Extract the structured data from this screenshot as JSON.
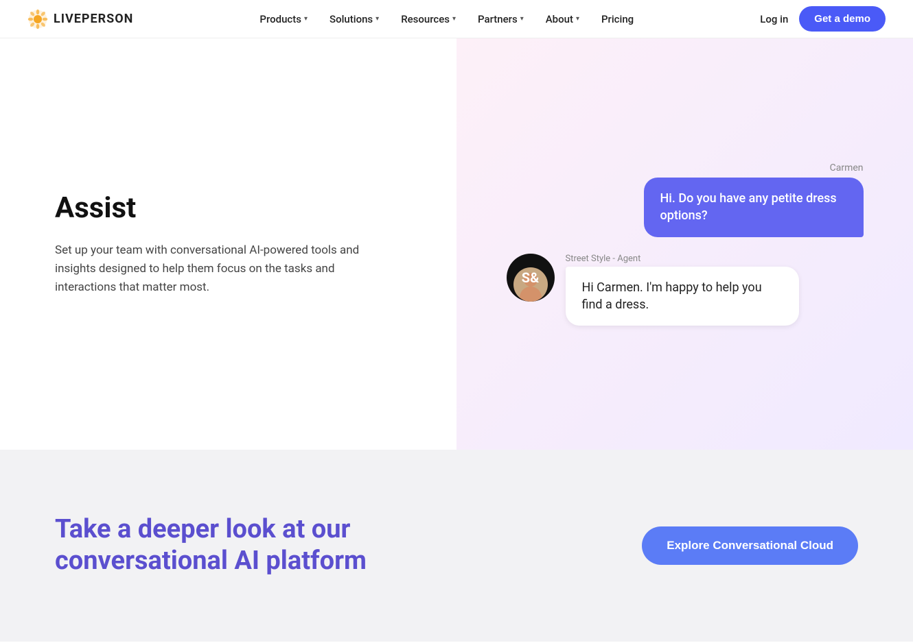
{
  "navbar": {
    "logo_text": "LIVEPERSON",
    "nav_items": [
      {
        "id": "products",
        "label": "Products",
        "has_dropdown": true
      },
      {
        "id": "solutions",
        "label": "Solutions",
        "has_dropdown": true
      },
      {
        "id": "resources",
        "label": "Resources",
        "has_dropdown": true
      },
      {
        "id": "partners",
        "label": "Partners",
        "has_dropdown": true
      },
      {
        "id": "about",
        "label": "About",
        "has_dropdown": true
      },
      {
        "id": "pricing",
        "label": "Pricing",
        "has_dropdown": false
      }
    ],
    "login_label": "Log in",
    "demo_label": "Get a demo"
  },
  "main": {
    "section_title": "Assist",
    "section_desc": "Set up your team with conversational AI-powered tools and insights designed to help them focus on the tasks and interactions that matter most."
  },
  "chat": {
    "user_label": "Carmen",
    "user_message": "Hi. Do you have any petite dress options?",
    "agent_name": "Street Style - Agent",
    "agent_message": "Hi Carmen. I'm happy to help you find a dress.",
    "agent_initials": "S&"
  },
  "cta": {
    "heading": "Take a deeper look at our conversational AI platform",
    "button_label": "Explore Conversational Cloud"
  }
}
